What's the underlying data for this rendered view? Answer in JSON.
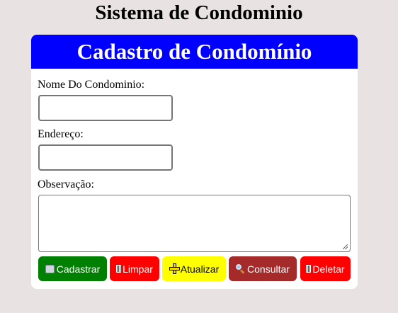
{
  "page": {
    "title": "Sistema de Condominio"
  },
  "form": {
    "header": "Cadastro de Condomínio",
    "fields": {
      "nome": {
        "label": "Nome Do Condominio:",
        "value": ""
      },
      "endereco": {
        "label": "Endereço:",
        "value": ""
      },
      "observacao": {
        "label": "Observação:",
        "value": ""
      }
    },
    "buttons": {
      "cadastrar": {
        "label": "Cadastrar",
        "icon": "book-icon",
        "color": "#008000"
      },
      "limpar": {
        "label": "Limpar",
        "icon": "trash-icon",
        "color": "#ff0000"
      },
      "atualizar": {
        "label": "Atualizar",
        "icon": "plus-icon",
        "color": "#ffff00"
      },
      "consultar": {
        "label": "Consultar",
        "icon": "magnifier-icon",
        "color": "#a52a2a"
      },
      "deletar": {
        "label": "Deletar",
        "icon": "trash-icon",
        "color": "#ff0000"
      }
    }
  },
  "colors": {
    "background": "#e9e2e2",
    "header": "#0000ff"
  }
}
